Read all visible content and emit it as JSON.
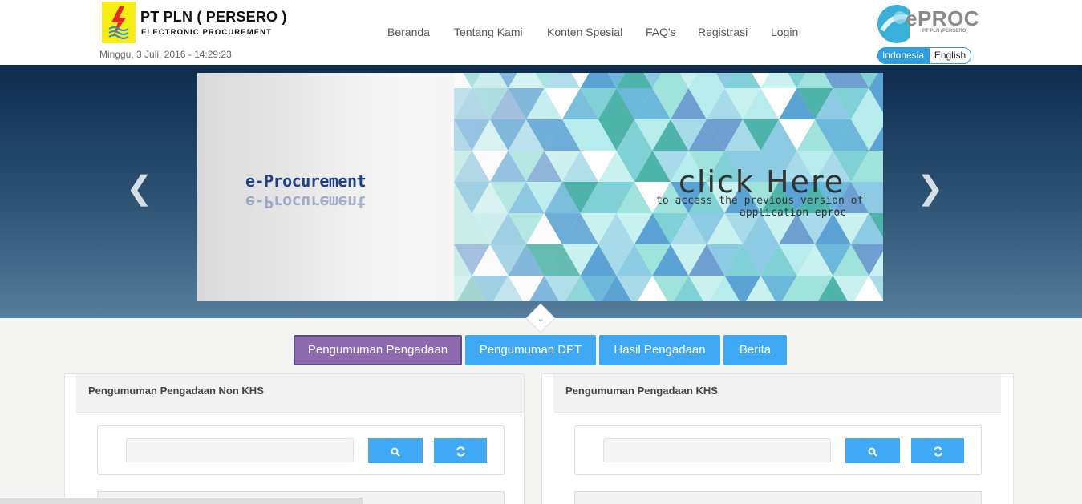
{
  "header": {
    "brand_title": "PT PLN ( PERSERO )",
    "brand_sub": "ELECTRONIC PROCUREMENT",
    "datetime": "Minggu, 3 Juli, 2016 - 14:29:23",
    "logo_text": "ePROC",
    "logo_sub": "PT PLN (PERSERO)"
  },
  "nav": {
    "items": [
      "Beranda",
      "Tentang Kami",
      "Konten Spesial",
      "FAQ's",
      "Registrasi",
      "Login"
    ]
  },
  "lang": {
    "indonesia": "Indonesia",
    "english": "English",
    "selected": "Indonesia"
  },
  "slider": {
    "ep_title": "e-Procurement",
    "click_here": "click Here",
    "sub1": "to access the previous version of",
    "sub2": "application eproc"
  },
  "tabs": {
    "items": [
      "Pengumuman Pengadaan",
      "Pengumuman DPT",
      "Hasil Pengadaan",
      "Berita"
    ],
    "active": "Pengumuman Pengadaan"
  },
  "panels": {
    "left_title": "Pengumuman Pengadaan Non KHS",
    "right_title": "Pengumuman Pengadaan KHS"
  },
  "colors": {
    "accent": "#3fa9f5",
    "active_tab": "#8e6bb0",
    "logo_yellow": "#f7ec13"
  }
}
